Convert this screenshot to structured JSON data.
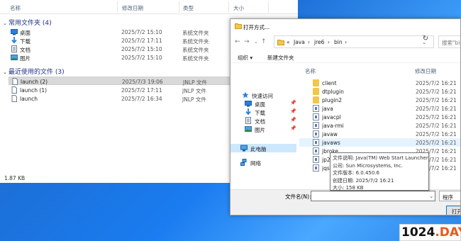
{
  "background_explorer": {
    "columns": {
      "name": "名称",
      "date": "修改日期",
      "type": "类型",
      "size": "大小"
    },
    "groups": [
      {
        "label": "常用文件夹 (4)",
        "items": [
          {
            "name": "桌面",
            "date": "2025/7/2 15:10",
            "type": "系统文件夹",
            "icon": "desktop-folder-icon"
          },
          {
            "name": "下载",
            "date": "2025/7/2 17:11",
            "type": "系统文件夹",
            "icon": "download-arrow-icon"
          },
          {
            "name": "文档",
            "date": "2025/7/2 15:10",
            "type": "系统文件夹",
            "icon": "documents-icon"
          },
          {
            "name": "图片",
            "date": "2025/7/2 15:10",
            "type": "系统文件夹",
            "icon": "pictures-icon"
          }
        ]
      },
      {
        "label": "最近使用的文件 (3)",
        "items": [
          {
            "name": "launch (2)",
            "date": "2025/7/3 19:06",
            "type": "JNLP 文件",
            "icon": "file-icon",
            "selected": true
          },
          {
            "name": "launch (1)",
            "date": "2025/7/2 17:11",
            "type": "JNLP 文件",
            "icon": "file-icon"
          },
          {
            "name": "launch",
            "date": "2025/7/2 16:34",
            "type": "JNLP 文件",
            "icon": "file-icon"
          }
        ]
      }
    ],
    "status": "1.87 KB"
  },
  "dialog": {
    "title": "打开方式...",
    "breadcrumb": [
      "«",
      "Java",
      "›",
      "jre6",
      "›",
      "bin",
      "›"
    ],
    "search_placeholder": "搜索\"bin\"",
    "toolbar": {
      "organize": "组织 ▾",
      "new_folder": "新建文件夹"
    },
    "nav_pane": [
      {
        "label": "快速访问",
        "icon": "star-icon"
      },
      {
        "label": "桌面",
        "icon": "desktop-icon",
        "pinned": true
      },
      {
        "label": "下载",
        "icon": "download-icon",
        "pinned": true
      },
      {
        "label": "文档",
        "icon": "documents-icon",
        "pinned": true
      },
      {
        "label": "图片",
        "icon": "pictures-icon",
        "pinned": true
      },
      {
        "label": "此电脑",
        "icon": "computer-icon",
        "selected": true
      },
      {
        "label": "网络",
        "icon": "network-icon"
      }
    ],
    "columns": {
      "name": "名称",
      "date": "修改日期"
    },
    "files": [
      {
        "name": "client",
        "date": "2025/7/2 16:21",
        "kind": "folder"
      },
      {
        "name": "dtplugin",
        "date": "2025/7/2 16:21",
        "kind": "folder"
      },
      {
        "name": "plugin2",
        "date": "2025/7/2 16:21",
        "kind": "folder"
      },
      {
        "name": "java",
        "date": "2025/7/2 16:21",
        "kind": "exe"
      },
      {
        "name": "javacpl",
        "date": "2025/7/2 16:21",
        "kind": "exe"
      },
      {
        "name": "java-rmi",
        "date": "2025/7/2 16:21",
        "kind": "exe"
      },
      {
        "name": "javaw",
        "date": "2025/7/2 16:21",
        "kind": "exe"
      },
      {
        "name": "javaws",
        "date": "2025/7/2 16:21",
        "kind": "exe",
        "hover": true
      },
      {
        "name": "jbroke",
        "date": "2025/7/2 16:21",
        "kind": "exe"
      },
      {
        "name": "jp2lau",
        "date": "2025/7/2 16:21",
        "kind": "exe"
      },
      {
        "name": "jqs",
        "date": "2025/7/2 16:21",
        "kind": "exe"
      }
    ],
    "tooltip": [
      "文件说明: Java(TM) Web Start Launcher",
      "公司: Sun Microsystems, Inc.",
      "文件版本: 6.0.450.6",
      "创建日期: 2025/7/2 16:21",
      "大小: 158 KB"
    ],
    "filename_label": "文件名(N):",
    "filename_value": "",
    "filetype": "程序",
    "open_button": "打开"
  },
  "watermark": {
    "main": "1024",
    "dot": ".",
    "suffix": "DAY"
  },
  "colors": {
    "accent": "#0078d7",
    "group_heading": "#1e3287",
    "folder": "#f3c649",
    "selection": "#cce8ff",
    "desktop_blue": "#1a7cf0"
  }
}
